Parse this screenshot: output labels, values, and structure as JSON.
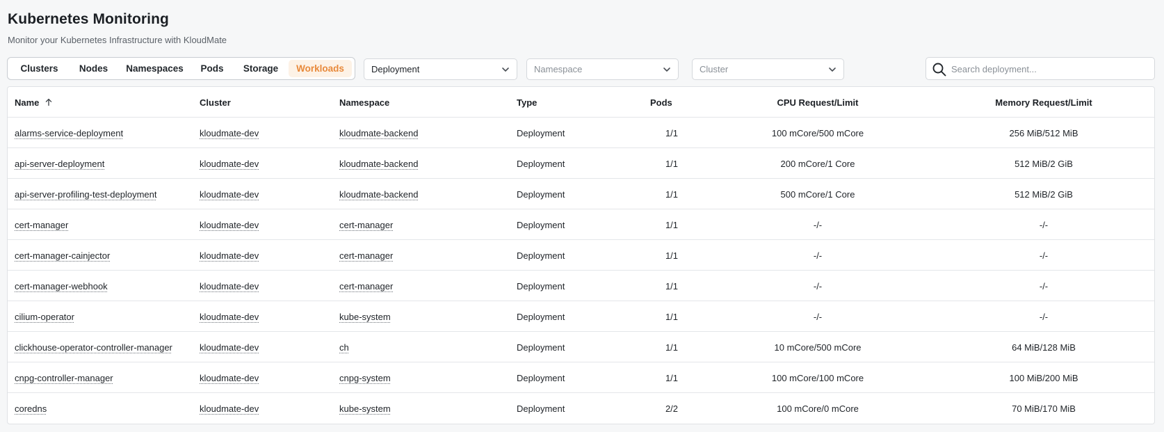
{
  "header": {
    "title": "Kubernetes Monitoring",
    "subtitle": "Monitor your Kubernetes Infrastructure with KloudMate"
  },
  "tabs": [
    {
      "label": "Clusters",
      "active": false
    },
    {
      "label": "Nodes",
      "active": false
    },
    {
      "label": "Namespaces",
      "active": false
    },
    {
      "label": "Pods",
      "active": false
    },
    {
      "label": "Storage",
      "active": false
    },
    {
      "label": "Workloads",
      "active": true
    }
  ],
  "filters": {
    "workload_type": {
      "value": "Deployment"
    },
    "namespace": {
      "placeholder": "Namespace"
    },
    "cluster": {
      "placeholder": "Cluster"
    },
    "search": {
      "placeholder": "Search deployment...",
      "icon": "search-icon"
    }
  },
  "colors": {
    "accent": "#e8893a",
    "accent_bg": "#fdf2e6"
  },
  "table": {
    "columns": [
      "Name",
      "Cluster",
      "Namespace",
      "Type",
      "Pods",
      "CPU Request/Limit",
      "Memory Request/Limit"
    ],
    "sort": {
      "column": "Name",
      "direction": "ascending",
      "icon": "arrow-up-icon"
    },
    "rows": [
      {
        "name": "alarms-service-deployment",
        "cluster": "kloudmate-dev",
        "namespace": "kloudmate-backend",
        "type": "Deployment",
        "pods": "1/1",
        "cpu": "100 mCore/500 mCore",
        "memory": "256 MiB/512 MiB"
      },
      {
        "name": "api-server-deployment",
        "cluster": "kloudmate-dev",
        "namespace": "kloudmate-backend",
        "type": "Deployment",
        "pods": "1/1",
        "cpu": "200 mCore/1 Core",
        "memory": "512 MiB/2 GiB"
      },
      {
        "name": "api-server-profiling-test-deployment",
        "cluster": "kloudmate-dev",
        "namespace": "kloudmate-backend",
        "type": "Deployment",
        "pods": "1/1",
        "cpu": "500 mCore/1 Core",
        "memory": "512 MiB/2 GiB"
      },
      {
        "name": "cert-manager",
        "cluster": "kloudmate-dev",
        "namespace": "cert-manager",
        "type": "Deployment",
        "pods": "1/1",
        "cpu": "-/-",
        "memory": "-/-"
      },
      {
        "name": "cert-manager-cainjector",
        "cluster": "kloudmate-dev",
        "namespace": "cert-manager",
        "type": "Deployment",
        "pods": "1/1",
        "cpu": "-/-",
        "memory": "-/-"
      },
      {
        "name": "cert-manager-webhook",
        "cluster": "kloudmate-dev",
        "namespace": "cert-manager",
        "type": "Deployment",
        "pods": "1/1",
        "cpu": "-/-",
        "memory": "-/-"
      },
      {
        "name": "cilium-operator",
        "cluster": "kloudmate-dev",
        "namespace": "kube-system",
        "type": "Deployment",
        "pods": "1/1",
        "cpu": "-/-",
        "memory": "-/-"
      },
      {
        "name": "clickhouse-operator-controller-manager",
        "cluster": "kloudmate-dev",
        "namespace": "ch",
        "type": "Deployment",
        "pods": "1/1",
        "cpu": "10 mCore/500 mCore",
        "memory": "64 MiB/128 MiB"
      },
      {
        "name": "cnpg-controller-manager",
        "cluster": "kloudmate-dev",
        "namespace": "cnpg-system",
        "type": "Deployment",
        "pods": "1/1",
        "cpu": "100 mCore/100 mCore",
        "memory": "100 MiB/200 MiB"
      },
      {
        "name": "coredns",
        "cluster": "kloudmate-dev",
        "namespace": "kube-system",
        "type": "Deployment",
        "pods": "2/2",
        "cpu": "100 mCore/0 mCore",
        "memory": "70 MiB/170 MiB"
      }
    ]
  }
}
